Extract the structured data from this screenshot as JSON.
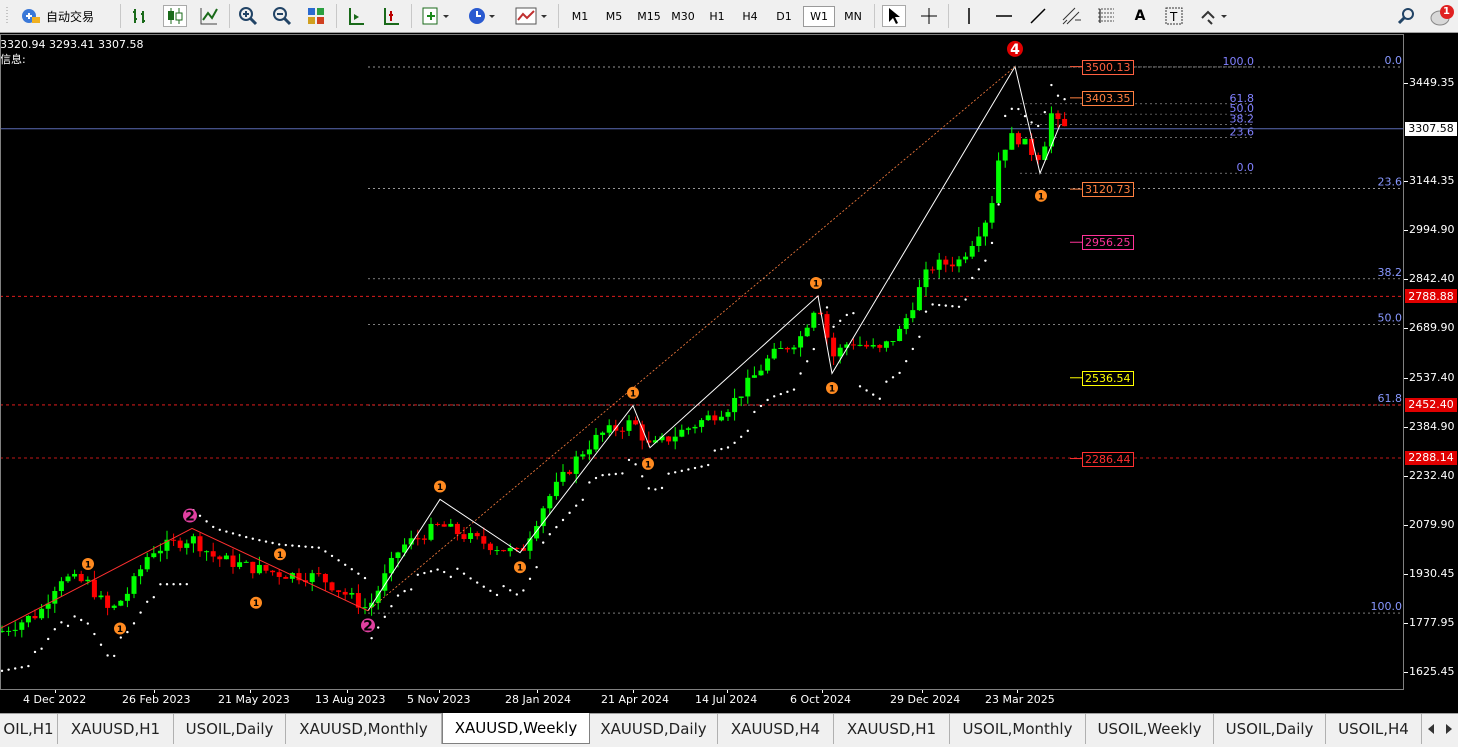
{
  "toolbar": {
    "autotrade_label": "自动交易",
    "timeframes": [
      "M1",
      "M5",
      "M15",
      "M30",
      "H1",
      "H4",
      "D1",
      "W1",
      "MN"
    ],
    "active_timeframe": "W1",
    "notification_count": "1"
  },
  "chart": {
    "symbol": "XAUUSD",
    "period": "Weekly",
    "ohlc_line": "3320.94 3293.41 3307.58",
    "info_label": "信息:",
    "current_price": "3307.58",
    "colors": {
      "bull": "#00ff00",
      "bear": "#ff0000",
      "background": "#000000",
      "grid_level": "#c0c0c0",
      "current_line": "#5a6ab4"
    },
    "price_ticks": [
      "3449.35",
      "3144.35",
      "2994.90",
      "2842.40",
      "2689.90",
      "2537.40",
      "2384.90",
      "2232.40",
      "2079.90",
      "1930.45",
      "1777.95",
      "1625.45"
    ],
    "time_labels": [
      "4 Dec 2022",
      "26 Feb 2023",
      "21 May 2023",
      "13 Aug 2023",
      "5 Nov 2023",
      "28 Jan 2024",
      "21 Apr 2024",
      "14 Jul 2024",
      "6 Oct 2024",
      "29 Dec 2024",
      "23 Mar 2025"
    ],
    "axis_badges": [
      {
        "text": "3307.58",
        "style": "current"
      },
      {
        "text": "2788.88",
        "style": "red"
      },
      {
        "text": "2452.40",
        "style": "red"
      },
      {
        "text": "2288.14",
        "style": "red"
      }
    ],
    "level_boxes": [
      {
        "text": "3500.13",
        "color": "#ff6040"
      },
      {
        "text": "3403.35",
        "color": "#ff8040"
      },
      {
        "text": "3120.73",
        "color": "#ff8040"
      },
      {
        "text": "2956.25",
        "color": "#ff3399"
      },
      {
        "text": "2536.54",
        "color": "#ffff00"
      },
      {
        "text": "2286.44",
        "color": "#ff3030"
      }
    ],
    "fib_main": [
      "0.0",
      "23.6",
      "38.2",
      "50.0",
      "61.8",
      "100.0"
    ],
    "fib_small": [
      "100.0",
      "61.8",
      "50.0",
      "38.2",
      "23.6",
      "0.0"
    ],
    "wave_labels": [
      "4",
      "2",
      "2",
      "1",
      "1",
      "1",
      "1",
      "1",
      "1",
      "1",
      "1",
      "1",
      "1"
    ]
  },
  "tabs": [
    "OIL,H1",
    "XAUUSD,H1",
    "USOIL,Daily",
    "XAUUSD,Monthly",
    "XAUUSD,Weekly",
    "XAUUSD,Daily",
    "XAUUSD,H4",
    "XAUUSD,H1",
    "USOIL,Monthly",
    "USOIL,Weekly",
    "USOIL,Daily",
    "USOIL,H4"
  ],
  "active_tab": "XAUUSD,Weekly"
}
